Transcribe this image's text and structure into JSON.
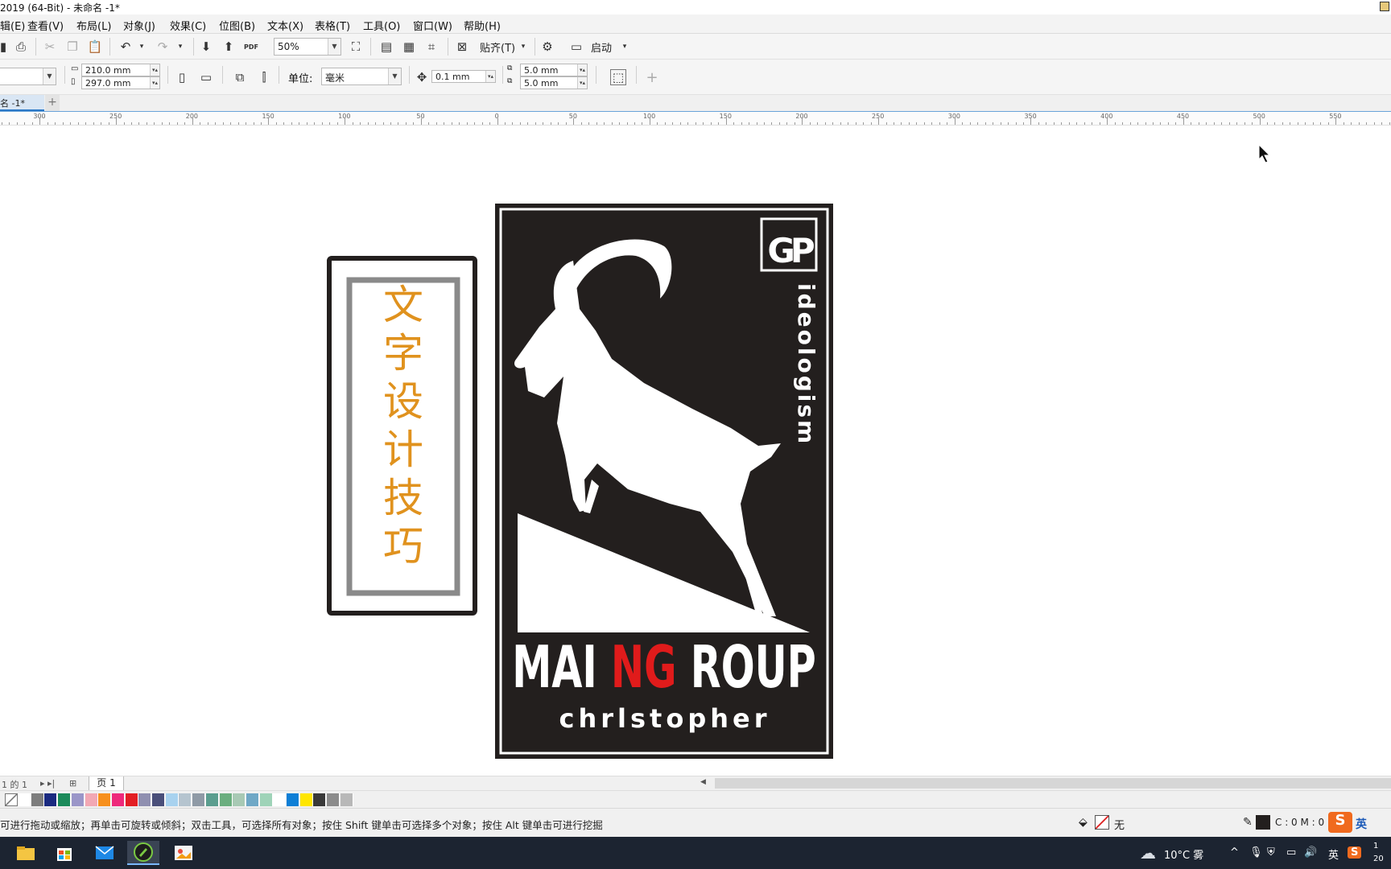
{
  "window": {
    "title": "2019 (64-Bit) - 未命名 -1*"
  },
  "menu": {
    "items": [
      "辑(E)",
      "查看(V)",
      "布局(L)",
      "对象(J)",
      "效果(C)",
      "位图(B)",
      "文本(X)",
      "表格(T)",
      "工具(O)",
      "窗口(W)",
      "帮助(H)"
    ]
  },
  "toolbar": {
    "zoom": "50%",
    "snap_label": "贴齐(T)",
    "launch_label": "启动",
    "pdf_label": "PDF"
  },
  "propbar": {
    "width": "210.0 mm",
    "height": "297.0 mm",
    "unit_label": "单位:",
    "unit_value": "毫米",
    "nudge": "0.1 mm",
    "dup_x": "5.0 mm",
    "dup_y": "5.0 mm"
  },
  "doc_tab": {
    "label": "名 -1*"
  },
  "ruler": {
    "labels": [
      "300",
      "250",
      "200",
      "150",
      "100",
      "50",
      "0",
      "50",
      "100",
      "150",
      "200",
      "250",
      "300",
      "350",
      "400",
      "450",
      "500",
      "550"
    ]
  },
  "canvas": {
    "left_card": {
      "chars": [
        "文",
        "字",
        "设",
        "计",
        "技",
        "巧"
      ],
      "text_color": "#e0921e"
    },
    "logo": {
      "monogram": "GP",
      "vertical_text": "ideologism",
      "brand_part1": "MAI ",
      "brand_part2": "NG",
      "brand_part3": " ROUP",
      "tagline": "chrlstopher",
      "bg_color": "#231f1e",
      "accent_color": "#e01b1b"
    }
  },
  "page_nav": {
    "counter": "1 的 1",
    "page_tab": "页 1"
  },
  "palette": {
    "colors": [
      "#ffffff",
      "#7d7d7d",
      "#1a2a80",
      "#1b8a5a",
      "#9a96c8",
      "#f2a8b4",
      "#f7901e",
      "#ee2a7b",
      "#e31e24",
      "#8f8fb0",
      "#4a4f7a",
      "#a8d2ef",
      "#b5c4cf",
      "#8f9aa6",
      "#5b9e8f",
      "#6bae7f",
      "#a8c9b4",
      "#6fa8c6",
      "#9fd3b8",
      "#ffffff",
      "#0e7fd6",
      "#ffe600",
      "#3a3a3a",
      "#8c8c8c",
      "#b8b8b8"
    ]
  },
  "status": {
    "message": "可进行拖动或缩放；再单击可旋转或倾斜；双击工具，可选择所有对象；按住 Shift 键单击可选择多个对象；按住 Alt 键单击可进行挖掘",
    "fill_label": "无",
    "color_readout": "C :  0 M :  0",
    "ime_label": "英"
  },
  "taskbar": {
    "weather": "10°C  雾",
    "lang": "英",
    "clock": "1\n20"
  }
}
